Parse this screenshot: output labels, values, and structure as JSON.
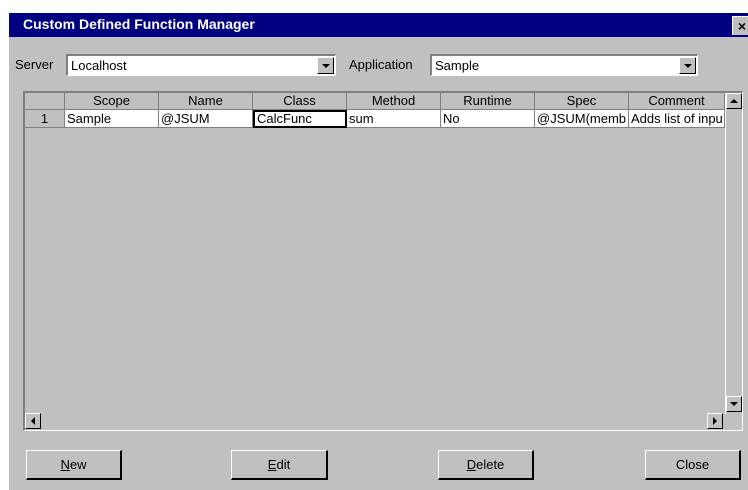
{
  "window": {
    "title": "Custom Defined Function Manager",
    "close_glyph": "×"
  },
  "server": {
    "label": "Server",
    "value": "Localhost"
  },
  "application": {
    "label": "Application",
    "value": "Sample"
  },
  "grid": {
    "columns": [
      "Scope",
      "Name",
      "Class",
      "Method",
      "Runtime",
      "Spec",
      "Comment"
    ],
    "rows": [
      {
        "num": "1",
        "cells": [
          "Sample",
          "@JSUM",
          "CalcFunc",
          "sum",
          "No",
          "@JSUM(memb",
          "Adds list of inpu"
        ]
      }
    ]
  },
  "buttons": {
    "new": {
      "accel": "N",
      "rest": "ew"
    },
    "edit": {
      "accel": "E",
      "rest": "dit"
    },
    "delete": {
      "accel": "D",
      "rest": "elete"
    },
    "close": "Close"
  },
  "icons": {
    "sysmenu": "window-sysmenu-icon",
    "dropdown": "chevron-down-icon"
  }
}
